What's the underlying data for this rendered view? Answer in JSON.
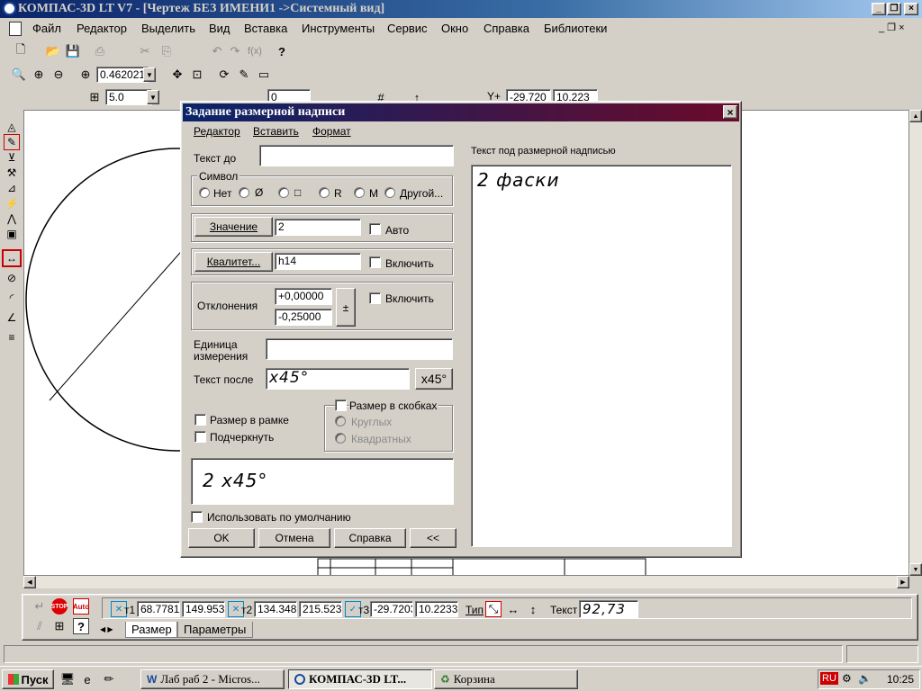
{
  "app": {
    "title": "КОМПАС-3D LT V7 - [Чертеж БЕЗ ИМЕНИ1 ->Системный вид]"
  },
  "menu": [
    "Файл",
    "Редактор",
    "Выделить",
    "Вид",
    "Вставка",
    "Инструменты",
    "Сервис",
    "Окно",
    "Справка",
    "Библиотеки"
  ],
  "toolbar": {
    "zoom_value": "0.462021",
    "step_value": "5.0",
    "angle_value": "0",
    "coord_x": "-29.720",
    "coord_y": "10.223",
    "coord_label": "Y+"
  },
  "dialog": {
    "title": "Задание размерной надписи",
    "menu": [
      "Редактор",
      "Вставить",
      "Формат"
    ],
    "text_before_label": "Текст до",
    "text_before_value": "",
    "symbol_group": "Символ",
    "symbols": [
      "Нет",
      "Ø",
      "□",
      "R",
      "M",
      "Другой..."
    ],
    "value_button": "Значение",
    "value_field": "2",
    "auto_label": "Авто",
    "qualitet_button": "Квалитет...",
    "qualitet_field": "h14",
    "enable_label_1": "Включить",
    "deviations_label": "Отклонения",
    "dev_upper": "+0,00000",
    "dev_lower": "-0,25000",
    "pm_button": "±",
    "enable_label_2": "Включить",
    "unit_label_1": "Единица",
    "unit_label_2": "измерения",
    "unit_value": "",
    "text_after_label": "Текст после",
    "text_after_value": "x45°",
    "x45_button": "x45°",
    "frame_label": "Размер в рамке",
    "underline_label": "Подчеркнуть",
    "brackets_label": "Размер в скобках",
    "round_label": "Круглых",
    "square_label": "Квадратных",
    "preview_text": "2 x45°",
    "default_label": "Использовать по умолчанию",
    "under_text_label": "Текст под размерной надписью",
    "under_text_value": "2 фаски",
    "ok": "OK",
    "cancel": "Отмена",
    "help": "Справка",
    "collapse": "<<"
  },
  "props": {
    "t1_label": "т1",
    "t1_x": "68.7781",
    "t1_y": "149.953",
    "t2_label": "т2",
    "t2_x": "134.348",
    "t2_y": "215.523",
    "t3_label": "т3",
    "t3_x": "-29.7203",
    "t3_y": "10.2233",
    "type_label": "Тип",
    "text_label": "Текст",
    "text_value": "92,73",
    "tabs": [
      "Размер",
      "Параметры"
    ]
  },
  "taskbar": {
    "start": "Пуск",
    "tasks": [
      "Лаб раб 2 - Micros...",
      "КОМПАС-3D LT...",
      "Корзина"
    ],
    "lang": "RU",
    "time": "10:25"
  }
}
